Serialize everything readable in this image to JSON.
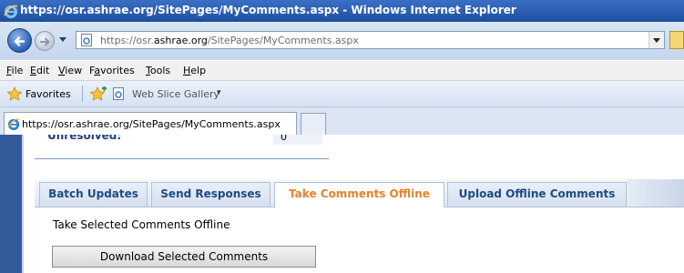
{
  "window": {
    "title": "https://osr.ashrae.org/SitePages/MyComments.aspx - Windows Internet Explorer"
  },
  "address": {
    "url_prefix": "https://osr.",
    "url_domain": "ashrae.org",
    "url_suffix": "/SitePages/MyComments.aspx"
  },
  "menu": {
    "items": [
      {
        "pre": "",
        "u": "F",
        "post": "ile"
      },
      {
        "pre": "",
        "u": "E",
        "post": "dit"
      },
      {
        "pre": "",
        "u": "V",
        "post": "iew"
      },
      {
        "pre": "F",
        "u": "a",
        "post": "vorites"
      },
      {
        "pre": "",
        "u": "T",
        "post": "ools"
      },
      {
        "pre": "",
        "u": "H",
        "post": "elp"
      }
    ]
  },
  "favorites": {
    "label": "Favorites",
    "web_slice": "Web Slice Gallery",
    "dropdown": "▾"
  },
  "browser_tab": {
    "label": "https://osr.ashrae.org/SitePages/MyComments.aspx"
  },
  "content": {
    "unresolved_label": "Unresolved:",
    "unresolved_value": "0",
    "tabs": [
      {
        "label": "Batch Updates"
      },
      {
        "label": "Send Responses"
      },
      {
        "label": "Take Comments Offline"
      },
      {
        "label": "Upload Offline Comments"
      }
    ],
    "active_tab": 2,
    "panel_text": "Take Selected Comments Offline",
    "download_button": "Download Selected Comments"
  },
  "colors": {
    "active_tab_text": "#e6822a",
    "tab_text": "#1f4a84",
    "left_bar": "#335b9c"
  }
}
